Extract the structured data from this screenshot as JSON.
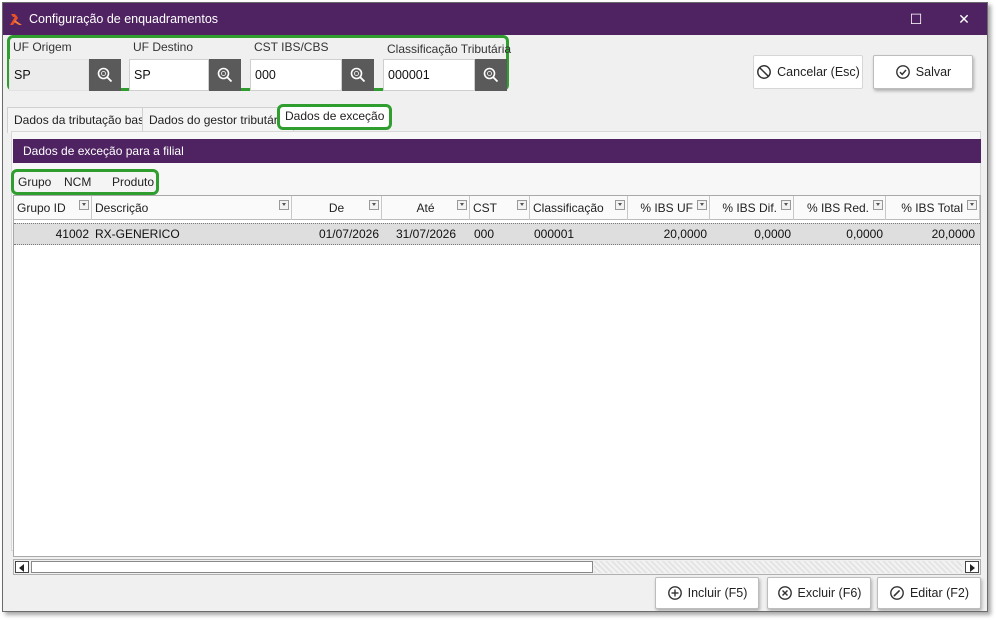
{
  "window": {
    "title": "Configuração de enquadramentos",
    "maximize_glyph": "☐",
    "close_glyph": "✕",
    "app_icon": "app-logo-icon",
    "accent_color": "#4f2362",
    "highlight_color": "#2f9e2f"
  },
  "filters": {
    "uf_origem": {
      "label": "UF Origem",
      "value": "SP"
    },
    "uf_destino": {
      "label": "UF Destino",
      "value": "SP"
    },
    "cst": {
      "label": "CST IBS/CBS",
      "value": "000"
    },
    "classificacao": {
      "label": "Classificação Tributária",
      "value": "000001"
    },
    "search_icon": "search-icon"
  },
  "actions": {
    "cancel_label": "Cancelar (Esc)",
    "save_label": "Salvar",
    "add_label": "Incluir (F5)",
    "delete_label": "Excluir (F6)",
    "edit_label": "Editar (F2)"
  },
  "tabs": [
    {
      "label": "Dados da tributação base"
    },
    {
      "label": "Dados do gestor tributário"
    },
    {
      "label": "Dados de exceção",
      "active": true
    }
  ],
  "section_title": "Dados de exceção para a filial",
  "subtabs": [
    {
      "label": "Grupo",
      "active": true
    },
    {
      "label": "NCM"
    },
    {
      "label": "Produto"
    }
  ],
  "grid": {
    "columns": [
      "Grupo ID",
      "Descrição",
      "De",
      "Até",
      "CST",
      "Classificação",
      "% IBS UF",
      "% IBS Dif.",
      "% IBS Red.",
      "% IBS Total"
    ],
    "rows": [
      {
        "grupo_id": "41002",
        "descricao": "RX-GENERICO",
        "de": "01/07/2026",
        "ate": "31/07/2026",
        "cst": "000",
        "classificacao": "000001",
        "ibs_uf": "20,0000",
        "ibs_dif": "0,0000",
        "ibs_red": "0,0000",
        "ibs_total": "20,0000"
      }
    ]
  }
}
